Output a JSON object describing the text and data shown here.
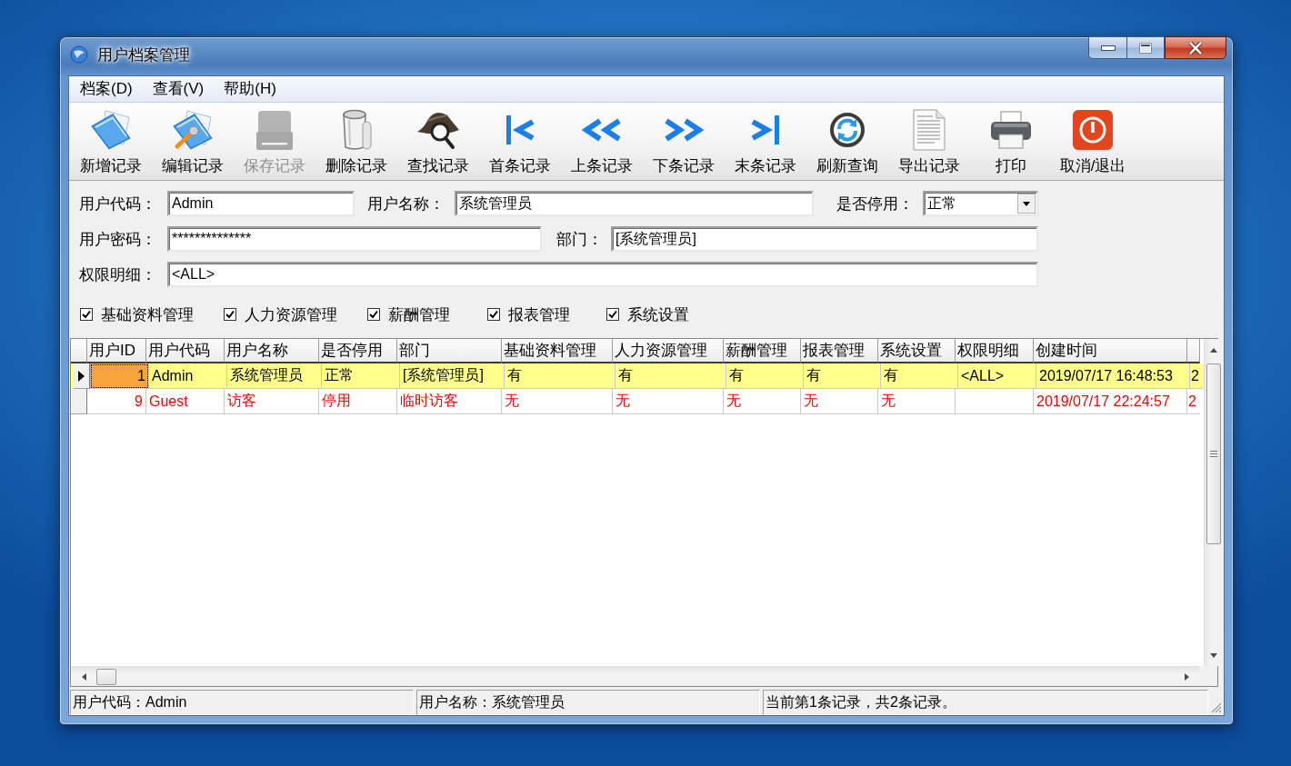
{
  "window": {
    "title": "用户档案管理"
  },
  "menu_bar": [
    "档案(D)",
    "查看(V)",
    "帮助(H)"
  ],
  "toolbar": [
    {
      "label": "新增记录",
      "disabled": false
    },
    {
      "label": "编辑记录",
      "disabled": false
    },
    {
      "label": "保存记录",
      "disabled": true
    },
    {
      "label": "删除记录",
      "disabled": false
    },
    {
      "label": "查找记录",
      "disabled": false
    },
    {
      "label": "首条记录",
      "disabled": false
    },
    {
      "label": "上条记录",
      "disabled": false
    },
    {
      "label": "下条记录",
      "disabled": false
    },
    {
      "label": "末条记录",
      "disabled": false
    },
    {
      "label": "刷新查询",
      "disabled": false
    },
    {
      "label": "导出记录",
      "disabled": false
    },
    {
      "label": "打印",
      "disabled": false
    },
    {
      "label": "取消/退出",
      "disabled": false
    }
  ],
  "form": {
    "user_code": {
      "label": "用户代码：",
      "value": "Admin"
    },
    "user_name": {
      "label": "用户名称：",
      "value": "系统管理员"
    },
    "disabled_status": {
      "label": "是否停用：",
      "value": "正常"
    },
    "password": {
      "label": "用户密码：",
      "value": "**************"
    },
    "department": {
      "label": "部门：",
      "value": "[系统管理员]"
    },
    "permissions": {
      "label": "权限明细：",
      "value": "<ALL>"
    }
  },
  "checkboxes": [
    {
      "label": "基础资料管理",
      "checked": true
    },
    {
      "label": "人力资源管理",
      "checked": true
    },
    {
      "label": "薪酬管理",
      "checked": true
    },
    {
      "label": "报表管理",
      "checked": true
    },
    {
      "label": "系统设置",
      "checked": true
    }
  ],
  "table": {
    "columns": [
      "用户ID",
      "用户代码",
      "用户名称",
      "是否停用",
      "部门",
      "基础资料管理",
      "人力资源管理",
      "薪酬管理",
      "报表管理",
      "系统设置",
      "权限明细",
      "创建时间"
    ],
    "rows": [
      {
        "selected": true,
        "disabled": false,
        "cells": [
          "1",
          "Admin",
          "系统管理员",
          "正常",
          "[系统管理员]",
          "有",
          "有",
          "有",
          "有",
          "有",
          "<ALL>",
          "2019/07/17 16:48:53",
          "2"
        ]
      },
      {
        "selected": false,
        "disabled": true,
        "cells": [
          "9",
          "Guest",
          "访客",
          "停用",
          "临时访客",
          "无",
          "无",
          "无",
          "无",
          "无",
          null,
          "2019/07/17 22:24:57",
          "2"
        ]
      }
    ]
  },
  "status_bar": [
    "用户代码：Admin",
    "用户名称：系统管理员",
    "当前第1条记录，共2条记录。"
  ]
}
